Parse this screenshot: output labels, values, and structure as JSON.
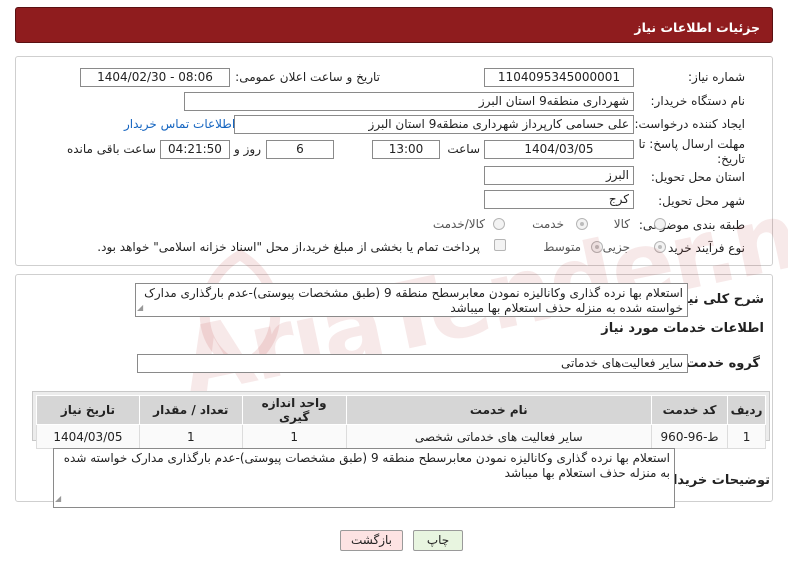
{
  "header": {
    "title": "جزئیات اطلاعات نیاز"
  },
  "form": {
    "need_number": {
      "label": "شماره نیاز:",
      "value": "1104095345000001"
    },
    "announce_datetime": {
      "label": "تاریخ و ساعت اعلان عمومی:",
      "value": "1404/02/30 - 08:06"
    },
    "buyer_org": {
      "label": "نام دستگاه خریدار:",
      "value": "شهرداری منطقه9 استان البرز"
    },
    "requester": {
      "label": "ایجاد کننده درخواست:",
      "value": "علی حسامی کارپرداز شهرداری منطقه9 استان البرز",
      "contact_link": "اطلاعات تماس خریدار"
    },
    "deadline": {
      "label": "مهلت ارسال پاسخ: تا تاریخ:",
      "date": "1404/03/05",
      "time_label": "ساعت",
      "time": "13:00",
      "days": "6",
      "days_label": "روز و",
      "remaining": "04:21:50",
      "remaining_label": "ساعت باقی مانده"
    },
    "province": {
      "label": "استان محل تحویل:",
      "value": "البرز"
    },
    "city": {
      "label": "شهر محل تحویل:",
      "value": "کرج"
    },
    "category": {
      "label": "طبقه بندی موضوعی:",
      "options": [
        "کالا",
        "خدمت",
        "کالا/خدمت"
      ],
      "selected": "خدمت"
    },
    "process_type": {
      "label": "نوع فرآیند خرید :",
      "options": [
        "جزیی",
        "متوسط"
      ],
      "selected": "جزیی",
      "payment_note": "پرداخت تمام یا بخشی از مبلغ خرید،از محل \"اسناد خزانه اسلامی\" خواهد بود."
    }
  },
  "summary": {
    "label": "شرح کلی نیاز:",
    "text": "استعلام بها نرده گذاری وکانالیزه نمودن معابرسطح منطقه 9 (طبق مشخصات پیوستی)-عدم بارگذاری مدارک خواسته شده به منزله حذف استعلام بها میباشد"
  },
  "services": {
    "section_title": "اطلاعات خدمات مورد نیاز",
    "group_label": "گروه خدمت:",
    "group_value": "سایر فعالیت‌های خدماتی",
    "columns": [
      "ردیف",
      "کد خدمت",
      "نام خدمت",
      "واحد اندازه گیری",
      "تعداد / مقدار",
      "تاریخ نیاز"
    ],
    "rows": [
      [
        "1",
        "ط-96-960",
        "سایر فعالیت های خدماتی شخصی",
        "1",
        "1",
        "1404/03/05"
      ]
    ]
  },
  "buyer_notes": {
    "label": "توضیحات خریدار:",
    "text": "استعلام بها نرده گذاری وکانالیزه نمودن معابرسطح منطقه 9 (طبق مشخصات پیوستی)-عدم بارگذاری مدارک خواسته شده به منزله حذف استعلام بها میباشد"
  },
  "buttons": {
    "print": "چاپ",
    "back": "بازگشت"
  },
  "watermark": {
    "text": "AriaTender.net"
  },
  "colors": {
    "header_bg": "#8f1c1e",
    "link": "#1565c0",
    "back_btn_bg": "#fde3e3",
    "print_btn_bg": "#e8f5e0"
  }
}
